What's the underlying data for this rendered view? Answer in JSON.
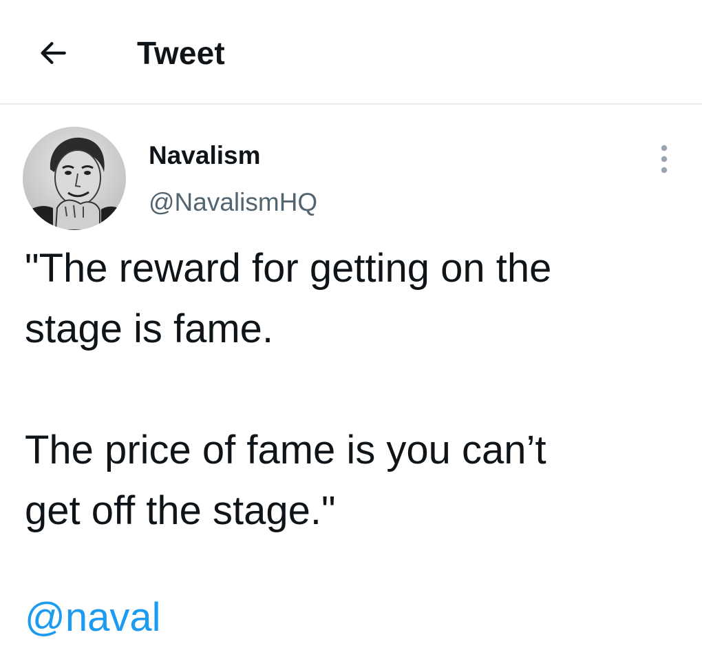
{
  "header": {
    "back_icon": "arrow-left-icon",
    "title": "Tweet"
  },
  "author": {
    "avatar_icon": "avatar-portrait",
    "name": "Navalism",
    "handle": "@NavalismHQ",
    "more_icon": "more-vertical-icon"
  },
  "tweet": {
    "lines": [
      "\"The reward for getting on the",
      "stage is fame.",
      "The price of fame is you can’t",
      "get off the stage.\""
    ],
    "mention": "@naval"
  },
  "colors": {
    "text": "#0f1419",
    "secondary": "#536471",
    "link": "#1d9bf0",
    "divider": "#e6ecf0"
  }
}
